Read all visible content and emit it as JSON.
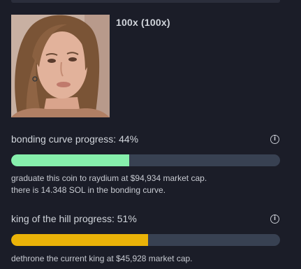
{
  "coin": {
    "name": "100x (100x)"
  },
  "bonding_curve": {
    "label": "bonding curve progress: 44%",
    "progress_percent": 44,
    "color": "#86efac",
    "line1": "graduate this coin to raydium at $94,934 market cap.",
    "line2": "there is 14.348 SOL in the bonding curve."
  },
  "king_of_hill": {
    "label": "king of the hill progress: 51%",
    "progress_percent": 51,
    "color": "#eab308",
    "line1": "dethrone the current king at $45,928 market cap."
  },
  "icons": {
    "info": "info-icon",
    "info_glyph": "i"
  },
  "colors": {
    "background": "#1b1d28",
    "track": "#384152"
  }
}
